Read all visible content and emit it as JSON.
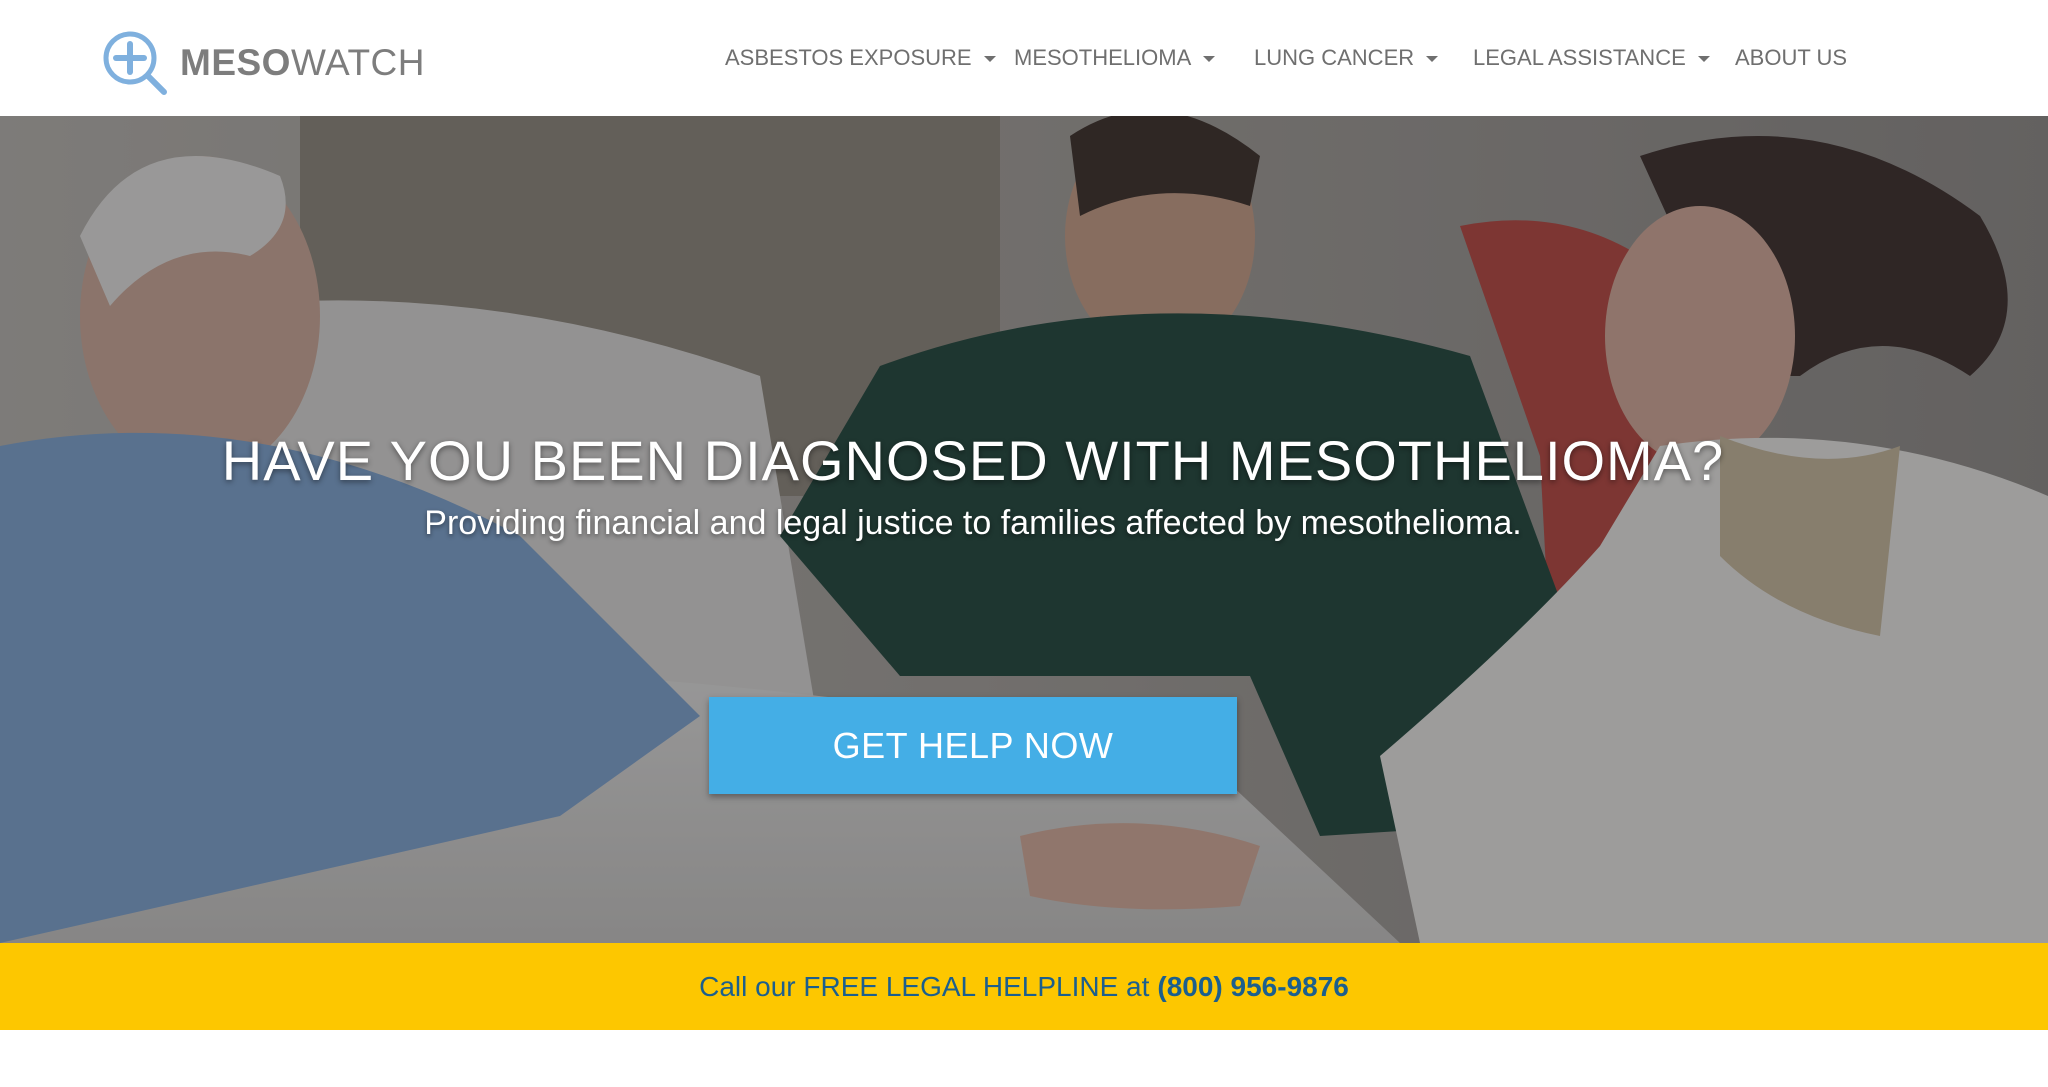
{
  "brand": {
    "name_bold": "MESO",
    "name_light": "WATCH",
    "accent_color": "#5b9bd5"
  },
  "nav": {
    "items": [
      {
        "label": "ASBESTOS EXPOSURE",
        "has_dropdown": true
      },
      {
        "label": "MESOTHELIOMA",
        "has_dropdown": true
      },
      {
        "label": "LUNG CANCER",
        "has_dropdown": true
      },
      {
        "label": "LEGAL ASSISTANCE",
        "has_dropdown": true
      },
      {
        "label": "ABOUT US",
        "has_dropdown": false
      }
    ]
  },
  "hero": {
    "title": "HAVE YOU BEEN DIAGNOSED WITH MESOTHELIOMA?",
    "subtitle": "Providing financial and legal justice to families affected by mesothelioma.",
    "cta_label": "GET HELP NOW",
    "cta_color": "#44aee6"
  },
  "helpline": {
    "prefix": "Call our FREE LEGAL HELPLINE at",
    "phone": "(800) 956-9876",
    "bar_color": "#fdc700",
    "text_color": "#1c5f8d"
  }
}
